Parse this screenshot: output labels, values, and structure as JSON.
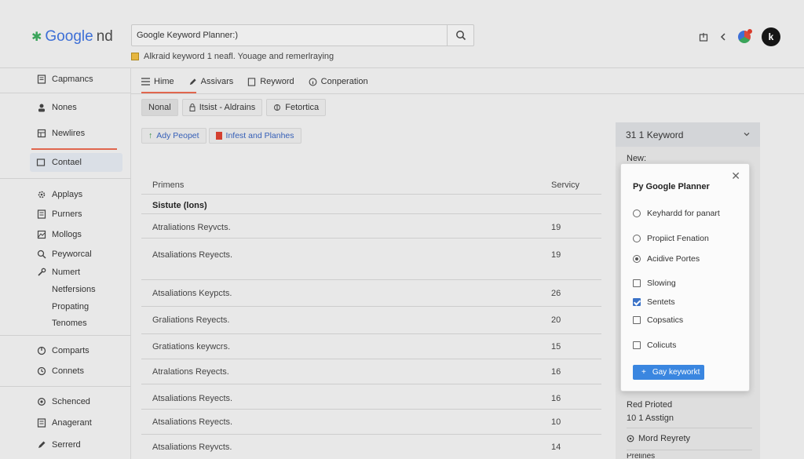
{
  "header": {
    "logo_text_blue": "Google",
    "logo_text_gray": "nd",
    "search_value": "Google Keyword Planner:)",
    "hint_text": "Alkraid keyword  1 neafl. Youage and remerlraying"
  },
  "sidebar": {
    "items": [
      {
        "label": "Capmancs"
      },
      {
        "label": "Nones"
      },
      {
        "label": "Newlires"
      },
      {
        "label": "Contael"
      },
      {
        "label": "Applays"
      },
      {
        "label": "Purners"
      },
      {
        "label": "Mollogs"
      },
      {
        "label": "Peyworcal"
      },
      {
        "label": "Numert"
      },
      {
        "label": "Netfersions"
      },
      {
        "label": "Propating"
      },
      {
        "label": "Tenomes"
      },
      {
        "label": "Comparts"
      },
      {
        "label": "Connets"
      },
      {
        "label": "Schenced"
      },
      {
        "label": "Anagerant"
      },
      {
        "label": "Serrerd"
      }
    ]
  },
  "tabs": [
    {
      "label": "Hime"
    },
    {
      "label": "Assivars"
    },
    {
      "label": "Reyword"
    },
    {
      "label": "Conperation"
    }
  ],
  "filters": [
    {
      "label": "Nonal"
    },
    {
      "label": "Itsist - Aldrains"
    },
    {
      "label": "Fetortica"
    }
  ],
  "actions": [
    {
      "label": "Ady Peopet"
    },
    {
      "label": "Infest and Planhes"
    }
  ],
  "table": {
    "col1": "Primens",
    "col2": "Servicy",
    "group": "Sistute (lons)",
    "rows": [
      {
        "name": "Atraliations Reyvcts.",
        "value": "19"
      },
      {
        "name": "Atsaliations Reyects.",
        "value": "19"
      },
      {
        "name": "Atsaliations Keypcts.",
        "value": "26"
      },
      {
        "name": "Graliations Reyects.",
        "value": "20"
      },
      {
        "name": "Gratiations keywcrs.",
        "value": "15"
      },
      {
        "name": "Atralations Reyects.",
        "value": "16"
      },
      {
        "name": "Atsaliations Reyects.",
        "value": "16"
      },
      {
        "name": "Atsaliations Reyects.",
        "value": "10"
      },
      {
        "name": "Atsaliations Reyvcts.",
        "value": "14"
      }
    ]
  },
  "right_panel": {
    "header": "31 1 Keyword",
    "new_label": "New:",
    "red_protected": "Red Prioted",
    "assign": "10 1 Asstign",
    "mord": "Mord Reyrety",
    "last": "Prelines"
  },
  "popup": {
    "title": "Py Google Planner",
    "radios": [
      {
        "label": "Keyhardd for panart",
        "checked": false
      },
      {
        "label": "Propiict Fenation",
        "checked": false
      },
      {
        "label": "Acidive Portes",
        "checked": true
      }
    ],
    "checkboxes": [
      {
        "label": "Slowing",
        "checked": false
      },
      {
        "label": "Sentets",
        "checked": true
      },
      {
        "label": "Copsatics",
        "checked": false
      },
      {
        "label": "Colicuts",
        "checked": false
      }
    ],
    "add_button": "Gay keyworkt"
  }
}
